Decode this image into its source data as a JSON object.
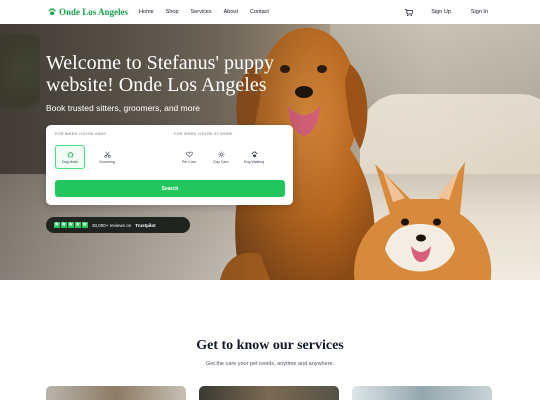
{
  "brand": {
    "name": "Onde Los Angeles",
    "accent": "#16a34a"
  },
  "nav": {
    "links": [
      "Home",
      "Shop",
      "Services",
      "About",
      "Contact"
    ],
    "cart_icon": "cart-icon",
    "sign_up": "Sign Up",
    "sign_in": "Sign In"
  },
  "hero": {
    "title": "Welcome to Stefanus' puppy website! Onde Los Angeles",
    "subtitle": "Book trusted sitters, groomers, and more"
  },
  "search_card": {
    "away_label": "FOR WHEN YOU'RE AWAY",
    "work_label": "FOR WHEN YOU'RE AT WORK",
    "away_services": [
      {
        "label": "Dog Hotel",
        "icon": "house-icon",
        "active": true
      },
      {
        "label": "Grooming",
        "icon": "scissors-icon",
        "active": false
      }
    ],
    "work_services": [
      {
        "label": "Pet Care",
        "icon": "heart-icon",
        "active": false
      },
      {
        "label": "Day Care",
        "icon": "sun-icon",
        "active": false
      },
      {
        "label": "Dog Walking",
        "icon": "paw-icon",
        "active": false
      }
    ],
    "search_button": "Search",
    "button_color": "#22c55e"
  },
  "rating": {
    "stars": 5,
    "reviews_text": "30,000+ reviews on",
    "platform": "Trustpilot"
  },
  "services": {
    "title": "Get to know our services",
    "subtitle": "Get the care your pet needs, anytime and anywhere."
  }
}
